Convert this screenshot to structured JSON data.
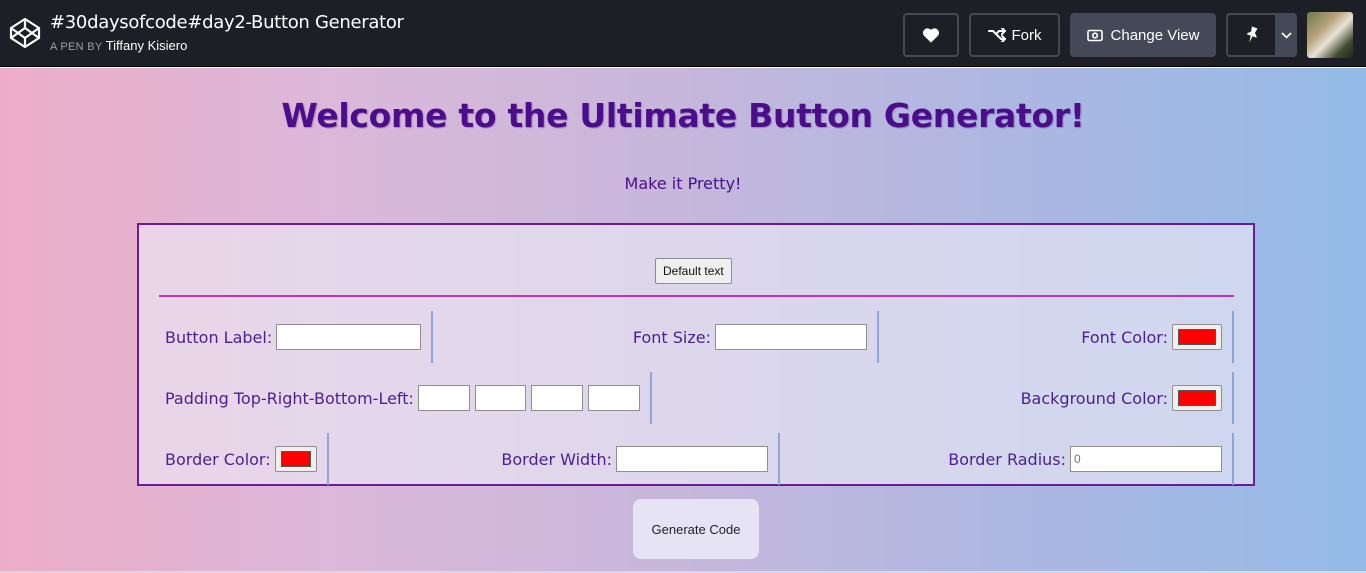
{
  "header": {
    "pen_title": "#30daysofcode#day2-Button Generator",
    "by_label": "A PEN BY",
    "author": "Tiffany Kisiero",
    "fork_label": "Fork",
    "change_view_label": "Change View",
    "icons": [
      "codepen-logo-icon",
      "heart-icon",
      "fork-icon",
      "eye-icon",
      "pin-icon",
      "chevron-down-icon"
    ]
  },
  "page": {
    "heading": "Welcome to the Ultimate Button Generator!",
    "subheading": "Make it Pretty!",
    "preview_button_label": "Default text",
    "generate_label": "Generate Code"
  },
  "form": {
    "button_label": {
      "label": "Button Label:",
      "value": ""
    },
    "font_size": {
      "label": "Font Size:",
      "value": ""
    },
    "font_color": {
      "label": "Font Color:",
      "value": "#ff0000"
    },
    "padding": {
      "label": "Padding Top-Right-Bottom-Left:",
      "values": [
        "",
        "",
        "",
        ""
      ]
    },
    "background_color": {
      "label": "Background Color:",
      "value": "#ff0000"
    },
    "border_color": {
      "label": "Border Color:",
      "value": "#ff0000"
    },
    "border_width": {
      "label": "Border Width:",
      "value": ""
    },
    "border_radius": {
      "label": "Border Radius:",
      "placeholder": "0"
    }
  },
  "colors": {
    "heading": "#4b0d8a",
    "panel_border": "#6a1b9a",
    "divider": "#c631b9",
    "swatch": "#ff0000"
  }
}
